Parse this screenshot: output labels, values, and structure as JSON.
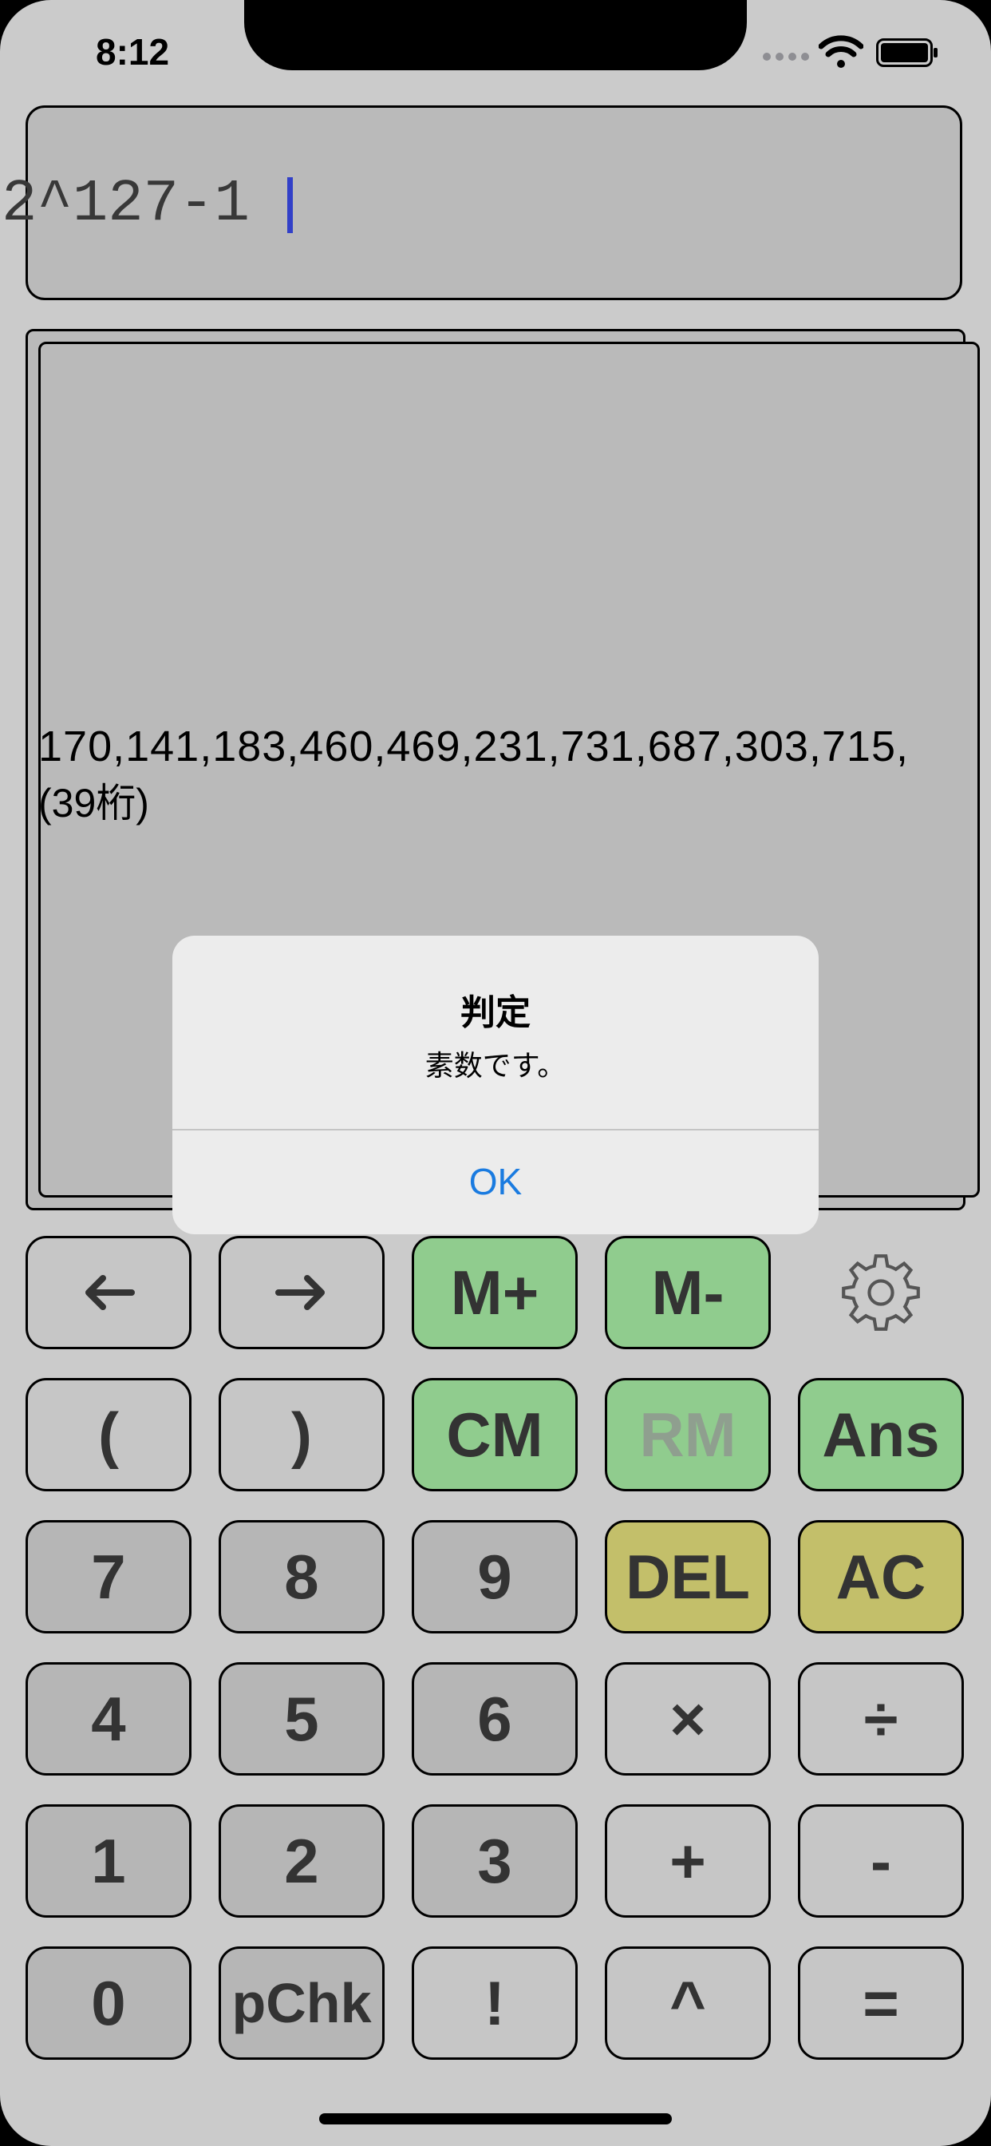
{
  "status_bar": {
    "time": "8:12"
  },
  "input": {
    "expression": "2^127-1"
  },
  "result": {
    "value": "170,141,183,460,469,231,731,687,303,715,",
    "digits": "(39桁)"
  },
  "alert": {
    "title": "判定",
    "message": "素数です。",
    "ok_label": "OK"
  },
  "keypad": {
    "row1": {
      "left": "←",
      "right": "→",
      "mplus": "M+",
      "mminus": "M-"
    },
    "row2": {
      "lparen": "(",
      "rparen": ")",
      "cm": "CM",
      "rm": "RM",
      "ans": "Ans"
    },
    "row3": {
      "k7": "7",
      "k8": "8",
      "k9": "9",
      "del": "DEL",
      "ac": "AC"
    },
    "row4": {
      "k4": "4",
      "k5": "5",
      "k6": "6",
      "times": "×",
      "divide": "÷"
    },
    "row5": {
      "k1": "1",
      "k2": "2",
      "k3": "3",
      "plus": "+",
      "minus": "-"
    },
    "row6": {
      "k0": "0",
      "pchk": "pChk",
      "fact": "!",
      "pow": "^",
      "equals": "="
    }
  },
  "colors": {
    "background": "#cbcbcb",
    "green_key": "#90cc8e",
    "yellow_key": "#c3bf6a",
    "number_key": "#b6b6b6",
    "caret": "#3240c8",
    "alert_action": "#1a7be0"
  },
  "icons": [
    "arrow-left-icon",
    "arrow-right-icon",
    "gear-icon",
    "wifi-icon",
    "battery-icon",
    "signal-icon"
  ]
}
